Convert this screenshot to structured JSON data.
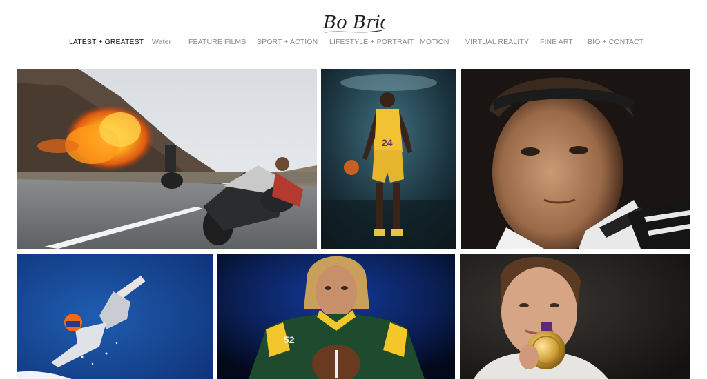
{
  "brand": {
    "logo_text": "Bo Bridges"
  },
  "nav": {
    "items": [
      {
        "label": "LATEST + GREATEST",
        "active": true
      },
      {
        "label": "Water",
        "active": false
      },
      {
        "label": "FEATURE FILMS",
        "active": false
      },
      {
        "label": "SPORT + ACTION",
        "active": false
      },
      {
        "label": "LIFESTYLE + PORTRAIT",
        "active": false
      },
      {
        "label": "MOTION",
        "active": false
      },
      {
        "label": "VIRTUAL REALITY",
        "active": false
      },
      {
        "label": "FINE ART",
        "active": false
      },
      {
        "label": "BIO + CONTACT",
        "active": false
      }
    ]
  },
  "gallery": {
    "jersey_number": "24",
    "football_number": "52"
  },
  "colors": {
    "nav_active": "#111111",
    "nav_inactive": "#8c8c8c",
    "background": "#ffffff"
  }
}
